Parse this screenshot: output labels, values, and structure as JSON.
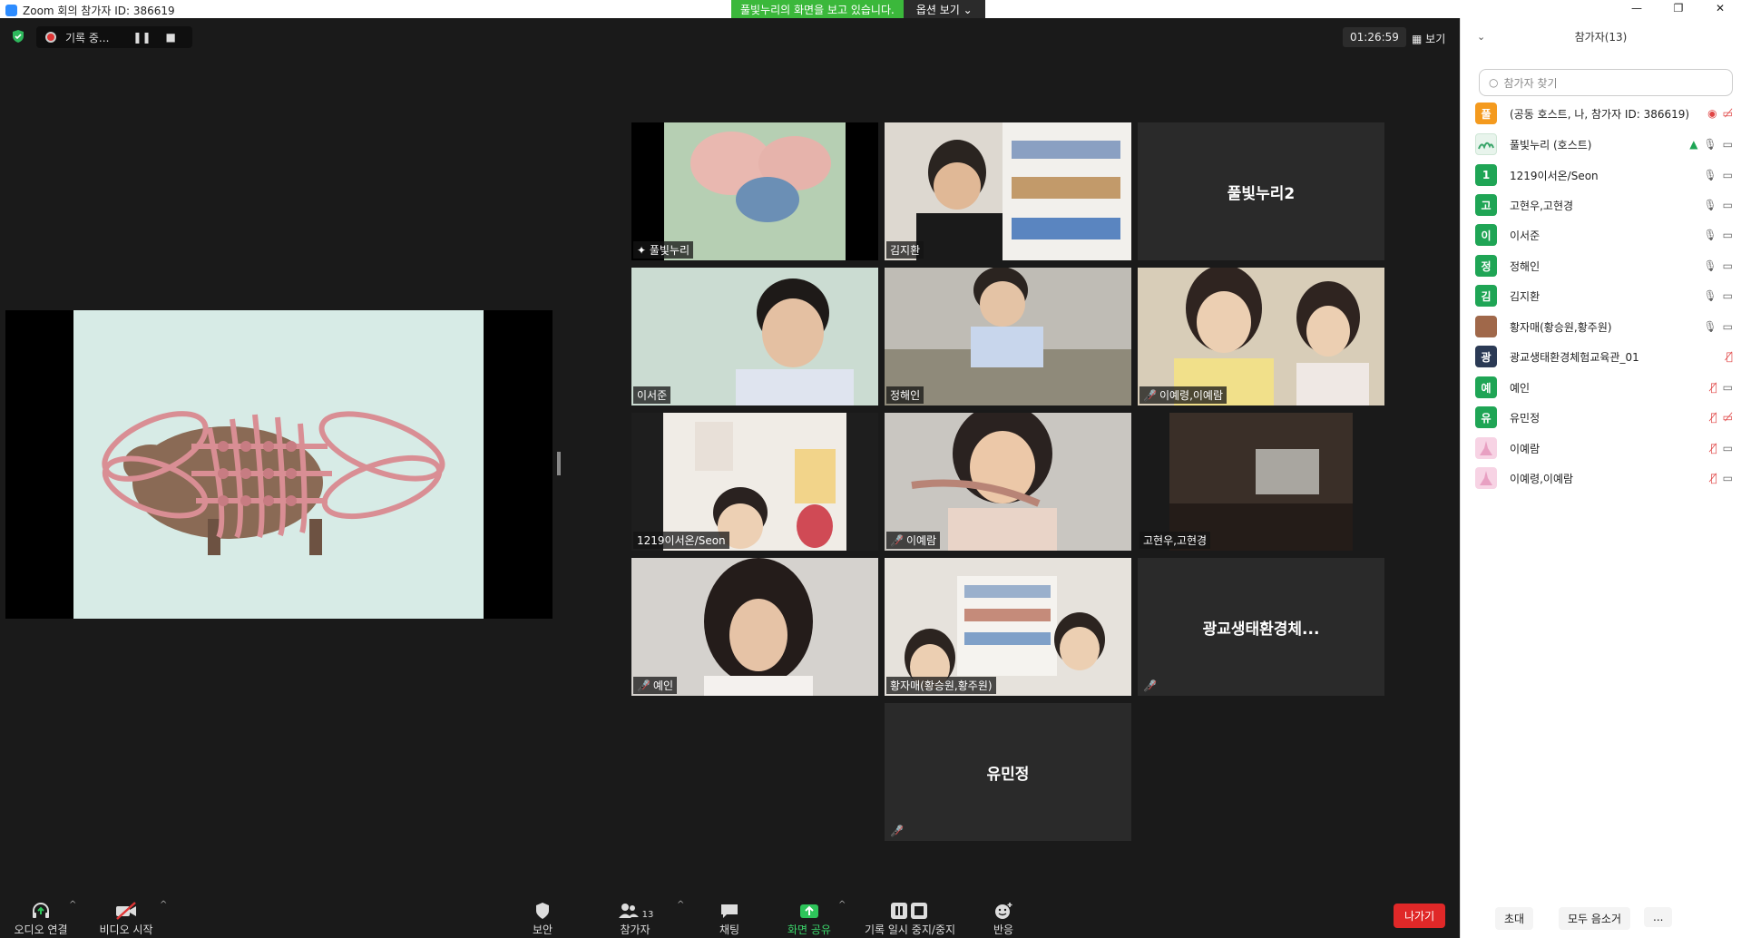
{
  "titlebar": {
    "title": "Zoom 회의 참가자 ID: 386619",
    "share_notice": "풀빛누리의 화면을 보고 있습니다.",
    "view_options": "옵션 보기 ⌄",
    "min": "—",
    "restore": "❐",
    "close": "✕"
  },
  "meeting": {
    "recording_label": "기록 중...",
    "timer": "01:26:59",
    "view_label": "보기"
  },
  "tiles": [
    {
      "name": "풀빛누리",
      "type": "video"
    },
    {
      "name": "김지환",
      "type": "video"
    },
    {
      "name": "풀빛누리2",
      "type": "name"
    },
    {
      "name": "이서준",
      "type": "video"
    },
    {
      "name": "정해인",
      "type": "video"
    },
    {
      "name": "이예령,이예람",
      "type": "video"
    },
    {
      "name": "1219이서온/Seon",
      "type": "video"
    },
    {
      "name": "이예람",
      "type": "video"
    },
    {
      "name": "고현우,고현경",
      "type": "video"
    },
    {
      "name": "예인",
      "type": "video"
    },
    {
      "name": "황자매(황승원,황주원)",
      "type": "video"
    },
    {
      "name": "광교생태환경체...",
      "type": "name"
    },
    {
      "name": "유민정",
      "type": "name"
    }
  ],
  "toolbar": {
    "audio": "오디오 연결",
    "video": "비디오 시작",
    "security": "보안",
    "participants": "참가자",
    "participants_count": "13",
    "chat": "채팅",
    "share": "화면 공유",
    "record": "기록 일시 중지/중지",
    "reactions": "반응",
    "leave": "나가기"
  },
  "panel": {
    "title": "참가자(13)",
    "search_placeholder": "참가자 찾기",
    "participants": [
      {
        "initial": "풀",
        "color": "#f49a1e",
        "name": "(공동 호스트, 나, 참가자 ID: 386619)"
      },
      {
        "initial": "",
        "color": "#ffffff",
        "name": "풀빛누리 (호스트)"
      },
      {
        "initial": "1",
        "color": "#1fa555",
        "name": "1219이서온/Seon"
      },
      {
        "initial": "고",
        "color": "#1fa555",
        "name": "고현우,고현경"
      },
      {
        "initial": "이",
        "color": "#1fa555",
        "name": "이서준"
      },
      {
        "initial": "정",
        "color": "#1fa555",
        "name": "정해인"
      },
      {
        "initial": "김",
        "color": "#1fa555",
        "name": "김지환"
      },
      {
        "initial": "",
        "color": "#a0684a",
        "name": "황자매(황승원,황주원)"
      },
      {
        "initial": "광",
        "color": "#2b3a55",
        "name": "광교생태환경체험교육관_01"
      },
      {
        "initial": "예",
        "color": "#1fa555",
        "name": "예인"
      },
      {
        "initial": "유",
        "color": "#1fa555",
        "name": "유민정"
      },
      {
        "initial": "",
        "color": "#f7d3e4",
        "name": "이예람"
      },
      {
        "initial": "",
        "color": "#f7d3e4",
        "name": "이예령,이예람"
      }
    ],
    "invite": "초대",
    "mute_all": "모두 음소거",
    "more": "..."
  }
}
